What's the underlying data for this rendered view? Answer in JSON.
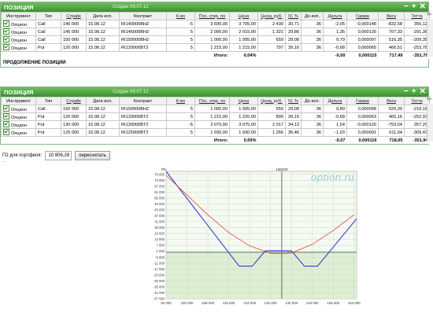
{
  "panel1": {
    "title": "ПОЗИЦИЯ",
    "created": "Создан 09.07.12",
    "columns": [
      "Инструмент",
      "Тип",
      "Страйк",
      "Дата исп.",
      "Контракт",
      "К-во",
      "Пос. откр. по",
      "Цена",
      "Цена, руб.",
      "IV, %",
      "До исп.",
      "Дельта",
      "Гамма",
      "Вега",
      "Тетта"
    ],
    "rows": [
      [
        "Опцион",
        "Call",
        "140 000",
        "15.08.12",
        "RI140000BH2",
        "-5",
        "3 690,00",
        "3 705,00",
        "2 430",
        "30,71",
        "36",
        "-2,05",
        "-0,000148",
        "-832,58",
        "355,12"
      ],
      [
        "Опцион",
        "Call",
        "145 000",
        "15.08.12",
        "RI145000BH2",
        "5",
        "2 000,00",
        "2 015,00",
        "1 321",
        "29,86",
        "36",
        "1,35",
        "0,000130",
        "707,33",
        "-291,36"
      ],
      [
        "Опцион",
        "Call",
        "150 000",
        "15.08.12",
        "RI150000BH2",
        "5",
        "1 000,00",
        "1 005,00",
        "659",
        "29,08",
        "36",
        "0,79",
        "0,000097",
        "516,35",
        "-209,35"
      ],
      [
        "Опцион",
        "Put",
        "120 000",
        "15.08.12",
        "RI120000BT2",
        "5",
        "1 215,00",
        "1 215,00",
        "797",
        "39,16",
        "36",
        "-0,68",
        "0,000065",
        "466,51",
        "-253,78"
      ]
    ],
    "total": {
      "label": "Итого:",
      "pct": "0,04%",
      "delta": "-0,00",
      "gamma": "0,000115",
      "vega": "717,49",
      "theta": "-351,78"
    },
    "continuation": "ПРОДОЛЖЕНИЕ ПОЗИЦИИ"
  },
  "panel2": {
    "title": "ПОЗИЦИЯ",
    "created": "Создан 09.07.12",
    "columns": [
      "Инструмент",
      "Тип",
      "Страйк",
      "Дата исп.",
      "Контракт",
      "К-во",
      "Пос. откр. по",
      "Цена",
      "Цена, руб.",
      "IV, %",
      "До исп.",
      "Дельта",
      "Гамма",
      "Вега",
      "Тетта"
    ],
    "rows": [
      [
        "Опцион",
        "Call",
        "150 000",
        "15.08.12",
        "RI150000BH2",
        "5",
        "1 000,00",
        "1 005,00",
        "659",
        "29,08",
        "36",
        "0,80",
        "0,000098",
        "520,39",
        "-210,18"
      ],
      [
        "Опцион",
        "Put",
        "120 000",
        "15.08.12",
        "RI120000BT2",
        "5",
        "1 215,00",
        "1 220,00",
        "800",
        "39,15",
        "36",
        "-0,68",
        "0,000063",
        "465,16",
        "-252,93"
      ],
      [
        "Опцион",
        "Put",
        "130 000",
        "15.08.12",
        "RI130000BT2",
        "-5",
        "3 070,00",
        "3 075,00",
        "2 017",
        "34,13",
        "36",
        "1,54",
        "-0,000120",
        "-753,54",
        "357,20"
      ],
      [
        "Опцион",
        "Put",
        "125 000",
        "15.08.12",
        "RI125000BT2",
        "5",
        "1 930,00",
        "1 930,00",
        "1 266",
        "36,46",
        "36",
        "-1,03",
        "0,000091",
        "611,04",
        "-309,43"
      ]
    ],
    "total": {
      "label": "Итого:",
      "pct": "0,00%",
      "delta": "-0,07",
      "gamma": "0,000116",
      "vega": "718,65",
      "theta": "-351,94"
    }
  },
  "controls": {
    "close": "−",
    "expand": "+",
    "remove": "✕",
    "plusminus": "+/-"
  },
  "portfolio": {
    "label": "ГО для портфеля:",
    "value": "10 806,28",
    "recalc": "пересчитать",
    "more": "..."
  },
  "watermark": "option.ru",
  "chart_data": {
    "type": "line",
    "ylabel": "P/L",
    "marker_label": "136320",
    "marker_x": 136320,
    "x_ticks": [
      92000,
      100000,
      108000,
      116000,
      124000,
      132000,
      140000,
      148000,
      156000,
      164000
    ],
    "x_tick_labels": [
      "92 000",
      "100 000",
      "108 000",
      "116 000",
      "124 000",
      "132 000",
      "140 000",
      "148 000",
      "156 000",
      "164 000"
    ],
    "y_ticks": [
      79000,
      73000,
      67000,
      61000,
      55000,
      49000,
      43000,
      37000,
      31000,
      25000,
      19000,
      13000,
      7000,
      1000,
      -5000,
      -11000,
      -17000,
      -23000,
      -29000,
      -35000,
      -41000,
      -47000
    ],
    "y_tick_labels": [
      "79 000",
      "73 000",
      "67 000",
      "61 000",
      "55 000",
      "49 000",
      "43 000",
      "37 000",
      "31 000",
      "25 000",
      "19 000",
      "13 000",
      "7 000",
      "1 000",
      "-5 000",
      "-11 000",
      "-17 000",
      "-23 000",
      "-29 000",
      "-35 000",
      "-41 000",
      "-47 000"
    ],
    "xlim": [
      92000,
      165000
    ],
    "ylim": [
      -47000,
      82000
    ],
    "grid": true,
    "series": [
      {
        "color": "#3a3ad8",
        "x": [
          92000,
          120000,
          125000,
          130000,
          135000,
          140000,
          145000,
          150000,
          165000
        ],
        "y": [
          82000,
          -14000,
          -14000,
          1500,
          1500,
          1500,
          -14000,
          -14000,
          34000
        ]
      },
      {
        "color": "#d84a3a",
        "x": [
          92000,
          100000,
          108000,
          116000,
          124000,
          132000,
          136000,
          140000,
          148000,
          156000,
          164000
        ],
        "y": [
          78000,
          58000,
          38000,
          20000,
          6500,
          -1000,
          -1500,
          -600,
          8000,
          22000,
          38000
        ]
      }
    ]
  }
}
